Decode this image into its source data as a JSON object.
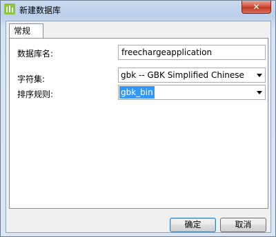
{
  "window": {
    "title": "新建数据库",
    "close_glyph": "✕"
  },
  "tabs": [
    {
      "label": "常规"
    }
  ],
  "form": {
    "db_name_label": "数据库名:",
    "db_name_value": "freechargeapplication",
    "charset_label": "字符集:",
    "charset_value": "gbk -- GBK Simplified Chinese",
    "collation_label": "排序规则:",
    "collation_value": "gbk_bin"
  },
  "buttons": {
    "ok": "确定",
    "cancel": "取消"
  }
}
